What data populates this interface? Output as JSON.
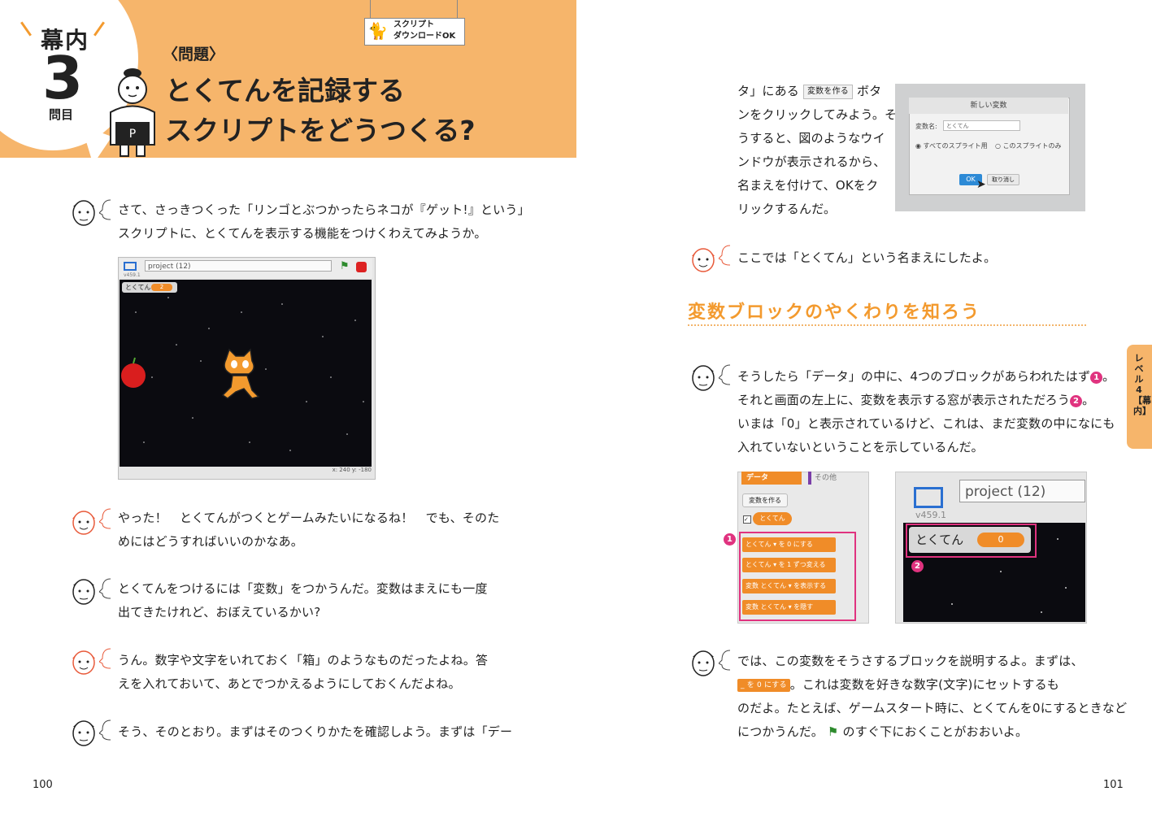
{
  "header": {
    "makuuchi": "幕内",
    "question_number": "3",
    "question_suffix": "問目",
    "mondai_label": "〈問題〉",
    "title_line1": "とくてんを記録する",
    "title_line2": "スクリプトをどうつくる?",
    "download_badge_line1": "スクリプト",
    "download_badge_line2": "ダウンロードOK",
    "sumo_belt_letter": "P"
  },
  "left_page": {
    "dialogues": [
      {
        "speaker": "teacher",
        "lines": [
          "さて、さっきつくった「リンゴとぶつかったらネコが『ゲット!』という」",
          "スクリプトに、とくてんを表示する機能をつけくわえてみようか。"
        ]
      },
      {
        "speaker": "student",
        "lines": [
          "やった！　とくてんがつくとゲームみたいになるね！　でも、そのた",
          "めにはどうすればいいのかなあ。"
        ]
      },
      {
        "speaker": "teacher",
        "lines": [
          "とくてんをつけるには「変数」をつかうんだ。変数はまえにも一度",
          "出てきたけれど、おぼえているかい?"
        ]
      },
      {
        "speaker": "student",
        "lines": [
          "うん。数字や文字をいれておく「箱」のようなものだったよね。答",
          "えを入れておいて、あとでつかえるようにしておくんだよね。"
        ]
      },
      {
        "speaker": "teacher",
        "lines": [
          "そう、そのとおり。まずはそのつくりかたを確認しよう。まずは「デー"
        ]
      }
    ],
    "stage": {
      "title": "project (12)",
      "version": "v459.1",
      "variable_name": "とくてん",
      "variable_value": "2",
      "coords": "x: 240   y: -180"
    },
    "page_number": "100"
  },
  "right_page": {
    "dialogue_top": [
      "タ」にある",
      "ボタ",
      "ンをクリックしてみよう。そ",
      "うすると、図のようなウイ",
      "ンドウが表示されるから、",
      "名まえを付けて、OKをク",
      "リックするんだ。"
    ],
    "inline_button": "変数を作る",
    "dialog": {
      "title": "新しい変数",
      "name_label": "変数名:",
      "name_value": "とくてん",
      "radio1": "すべてのスプライト用",
      "radio2": "このスプライトのみ",
      "ok": "OK",
      "cancel": "取り消し"
    },
    "student_line": "ここでは「とくてん」という名まえにしたよ。",
    "section_heading": "変数ブロックのやくわりを知ろう",
    "teacher_mid": [
      "そうしたら「データ」の中に、4つのブロックがあらわれたはず",
      "それと画面の左上に、変数を表示する窓が表示されただろう",
      "いまは「0」と表示されているけど、これは、まだ変数の中になにも",
      "入れていないということを示しているんだ。"
    ],
    "marker1": "1",
    "marker2": "2",
    "palette": {
      "tab_data": "データ",
      "tab_other": "その他",
      "make_var_button": "変数を作る",
      "reporter": "とくてん",
      "blocks": [
        "とくてん ▾ を 0 にする",
        "とくてん ▾ を 1 ずつ変える",
        "変数 とくてん ▾ を表示する",
        "変数 とくてん ▾ を隠す"
      ]
    },
    "stage_zoom": {
      "title": "project (12)",
      "version": "v459.1",
      "variable_name": "とくてん",
      "variable_value": "0"
    },
    "teacher_bottom": [
      "では、この変数をそうさするブロックを説明するよ。まずは、",
      "。これは変数を好きな数字(文字)にセットするも",
      "のだよ。たとえば、ゲームスタート時に、とくてんを0にするときなど",
      "につかうんだ。",
      "のすぐ下におくことがおおいよ。"
    ],
    "inline_block": "_ を 0 にする",
    "side_tab": "レベル4【幕内】",
    "page_number": "101"
  }
}
